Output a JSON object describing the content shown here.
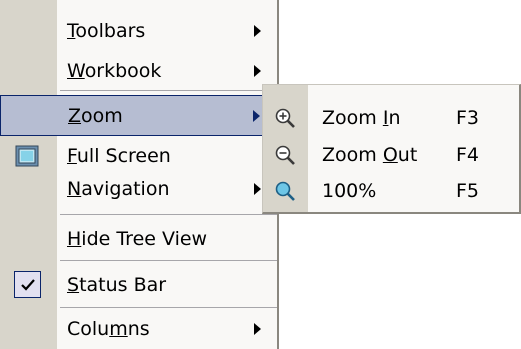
{
  "menu": {
    "items": [
      {
        "label_pre": "",
        "label_mn": "T",
        "label_post": "oolbars",
        "has_submenu": true
      },
      {
        "label_pre": "",
        "label_mn": "W",
        "label_post": "orkbook",
        "has_submenu": true
      },
      {
        "label_pre": "",
        "label_mn": "Z",
        "label_post": "oom",
        "has_submenu": true,
        "highlighted": true
      },
      {
        "label_pre": "",
        "label_mn": "F",
        "label_post": "ull Screen",
        "icon": "full-screen-icon"
      },
      {
        "label_pre": "",
        "label_mn": "N",
        "label_post": "avigation",
        "has_submenu": true
      },
      {
        "label_pre": "",
        "label_mn": "H",
        "label_post": "ide Tree View"
      },
      {
        "label_pre": "",
        "label_mn": "S",
        "label_post": "tatus Bar",
        "checked": true
      },
      {
        "label_pre": "Colu",
        "label_mn": "m",
        "label_post": "ns",
        "has_submenu": true
      }
    ]
  },
  "zoom_submenu": {
    "items": [
      {
        "label_pre": "Zoom ",
        "label_mn": "I",
        "label_post": "n",
        "shortcut": "F3",
        "icon": "zoom-in-icon"
      },
      {
        "label_pre": "Zoom ",
        "label_mn": "O",
        "label_post": "ut",
        "shortcut": "F4",
        "icon": "zoom-out-icon"
      },
      {
        "label_pre": "100%",
        "label_mn": "",
        "label_post": "",
        "shortcut": "F5",
        "icon": "zoom-100-icon"
      }
    ]
  },
  "colors": {
    "menu_bg": "#f9f8f6",
    "gutter": "#d8d5cb",
    "highlight_bg": "#b6bdd2",
    "highlight_border": "#0a246a"
  }
}
